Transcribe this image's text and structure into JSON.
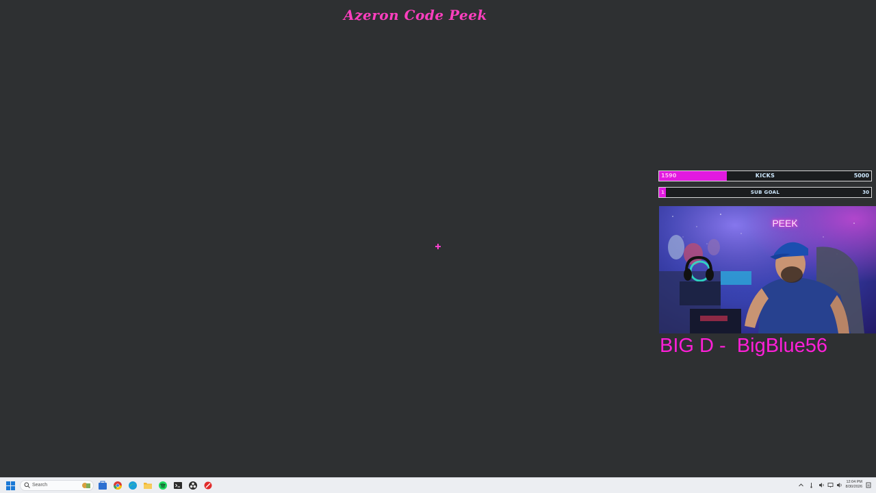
{
  "window": {
    "title": "Azeron Code Peek"
  },
  "overlay": {
    "kicks_goal": {
      "current": "1590",
      "label": "KICKS",
      "target": "5000",
      "progress": 0.318
    },
    "sub_goal": {
      "current": "1",
      "label": "SUB GOAL",
      "target": "30",
      "progress": 0.033
    },
    "webcam": {
      "sign_text": "PEEK"
    },
    "streamer_name": "BIG D -  BigBlue56"
  },
  "taskbar": {
    "search_placeholder": "Search",
    "pinned_icons": [
      "start-icon",
      "search-icon",
      "task-view-icon",
      "store-icon",
      "chrome-icon",
      "edge-icon",
      "file-explorer-icon",
      "spotify-icon",
      "terminal-icon",
      "obs-icon",
      "app-icon"
    ],
    "clock": {
      "time": "12:04 PM",
      "date": "8/30/2026"
    }
  },
  "colors": {
    "background": "#2e3032",
    "accent_pink": "#e21ae0",
    "title_pink": "#ff3fbf",
    "taskbar": "#eceef2"
  }
}
